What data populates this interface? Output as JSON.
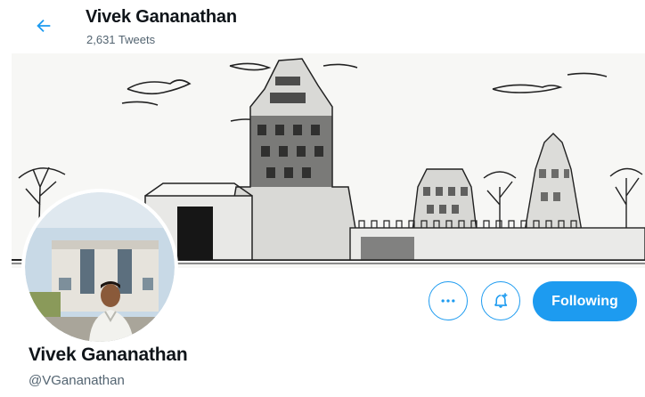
{
  "header": {
    "title": "Vivek Gananathan",
    "tweet_count": "2,631 Tweets"
  },
  "profile": {
    "name": "Vivek Gananathan",
    "handle": "@VGananathan"
  },
  "actions": {
    "more_icon": "ellipsis-icon",
    "notify_icon": "bell-plus-icon",
    "follow_label": "Following"
  },
  "colors": {
    "accent": "#1d9bf0",
    "text": "#0f1419",
    "secondary": "#536471"
  }
}
